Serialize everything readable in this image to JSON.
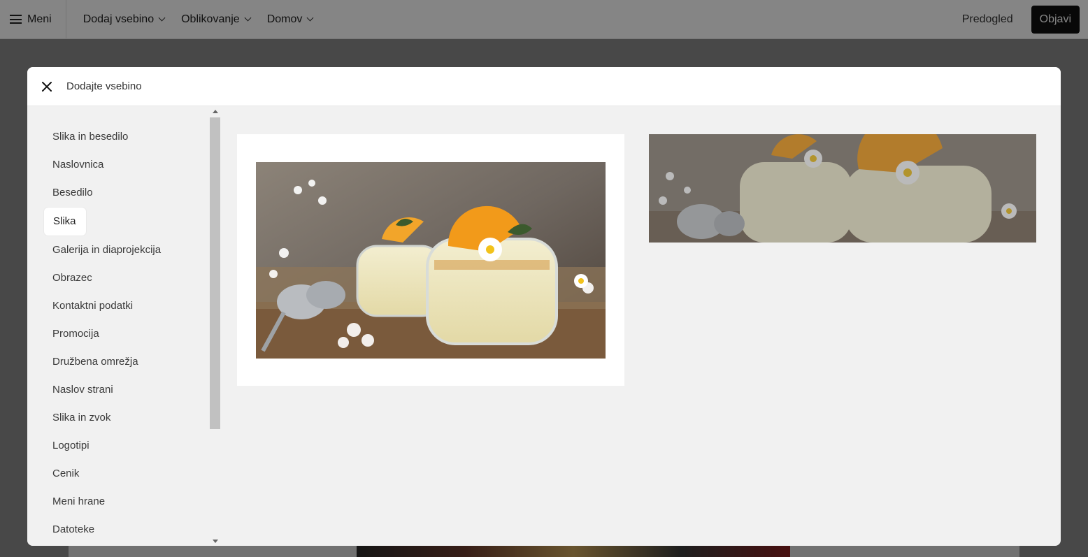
{
  "topbar": {
    "menu_label": "Meni",
    "add_content": "Dodaj vsebino",
    "design": "Oblikovanje",
    "home": "Domov",
    "preview": "Predogled",
    "publish": "Objavi"
  },
  "modal": {
    "title": "Dodajte vsebino",
    "sidebar": {
      "items": [
        {
          "label": "Slika in besedilo"
        },
        {
          "label": "Naslovnica"
        },
        {
          "label": "Besedilo"
        },
        {
          "label": "Slika",
          "active": true
        },
        {
          "label": "Galerija in diaprojekcija"
        },
        {
          "label": "Obrazec"
        },
        {
          "label": "Kontaktni podatki"
        },
        {
          "label": "Promocija"
        },
        {
          "label": "Družbena omrežja"
        },
        {
          "label": "Naslov strani"
        },
        {
          "label": "Slika in zvok"
        },
        {
          "label": "Logotipi"
        },
        {
          "label": "Cenik"
        },
        {
          "label": "Meni hrane"
        },
        {
          "label": "Datoteke"
        }
      ]
    },
    "templates": [
      {
        "kind": "image-boxed"
      },
      {
        "kind": "image-wide-dimmed"
      }
    ]
  },
  "colors": {
    "publish_bg": "#111111",
    "overlay": "rgba(0,0,0,0.48)",
    "modal_bg": "#f1f1f1"
  }
}
